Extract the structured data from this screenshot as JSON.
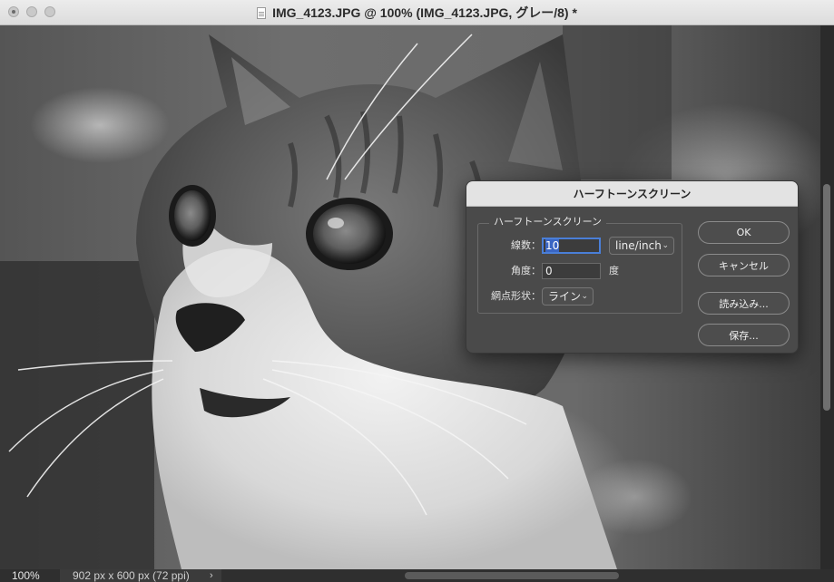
{
  "window": {
    "title": "IMG_4123.JPG @ 100% (IMG_4123.JPG, グレー/8) *"
  },
  "status": {
    "zoom": "100%",
    "doc_size": "902 px x 600 px (72 ppi)",
    "arrow": "›"
  },
  "dialog": {
    "title": "ハーフトーンスクリーン",
    "group_title": "ハーフトーンスクリーン",
    "frequency": {
      "label": "線数：",
      "value": "10",
      "unit_selected": "line/inch"
    },
    "angle": {
      "label": "角度：",
      "value": "0",
      "unit": "度"
    },
    "shape": {
      "label": "網点形状：",
      "selected": "ライン"
    },
    "buttons": {
      "ok": "OK",
      "cancel": "キャンセル",
      "load": "読み込み...",
      "save": "保存..."
    }
  },
  "icons": {
    "chevron": "⌄"
  }
}
